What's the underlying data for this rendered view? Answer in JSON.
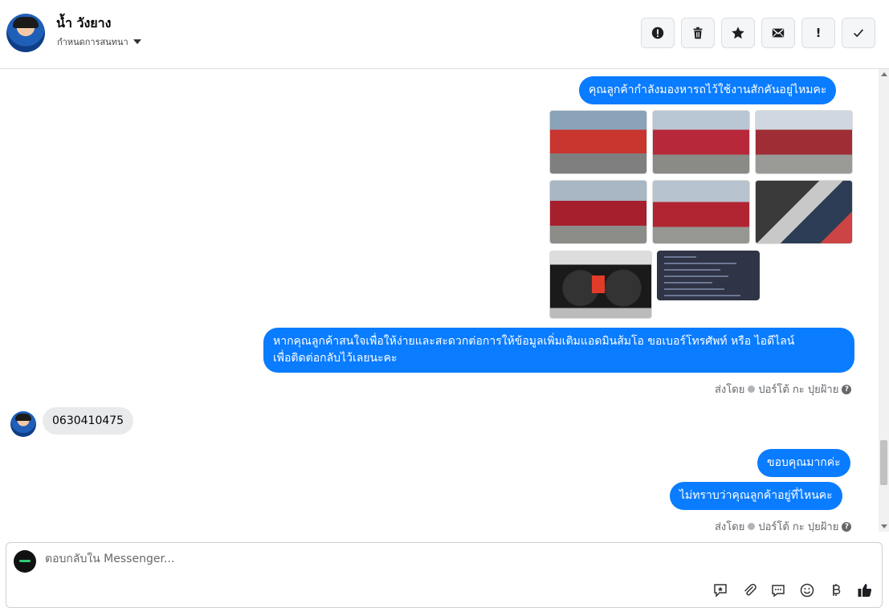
{
  "header": {
    "contact_name": "น้ำ วังยาง",
    "assign_label": "กำหนดการสนทนา",
    "toolbar": [
      {
        "name": "mark-spam-button",
        "icon": "alert-circle-icon"
      },
      {
        "name": "delete-button",
        "icon": "trash-icon"
      },
      {
        "name": "star-button",
        "icon": "star-icon"
      },
      {
        "name": "mark-unread-button",
        "icon": "envelope-icon"
      },
      {
        "name": "follow-up-button",
        "icon": "exclamation-icon",
        "label": "!"
      },
      {
        "name": "mark-done-button",
        "icon": "check-icon"
      }
    ]
  },
  "messages": {
    "m1": "คุณลูกค้ากำลังมองหารถไว้ใช้งานสักคันอยู่ไหมคะ",
    "m2_line1": "หากคุณลูกค้าสนใจเพื่อให้ง่ายและสะดวกต่อการให้ข้อมูลเพิ่มเติมแอดมินส้มโอ ขอเบอร์โทรศัพท์ หรือ ไอดีไลน์",
    "m2_line2": "เพื่อติดต่อกลับไว้เลยนะคะ",
    "sent_by_1": "ส่งโดย",
    "sender_1": "ปอร์โต้ กะ ปุยฝ้าย",
    "incoming": "0630410475",
    "m3": "ขอบคุณมากค่ะ",
    "m4": "ไม่ทราบว่าคุณลูกค้าอยู่ที่ไหนคะ",
    "sent_by_2": "ส่งโดย",
    "sender_2": "ปอร์โต้ กะ ปุยฝ้าย"
  },
  "attachments": {
    "photos": [
      "red-pickup-front-left",
      "red-pickup-front",
      "red-pickup-side",
      "red-pickup-front-lot",
      "red-pickup-rear",
      "pickup-interior-dashboard",
      "pickup-gauge-cluster",
      "vehicle-spec-card"
    ]
  },
  "composer": {
    "placeholder": "ตอบกลับใน Messenger...",
    "tools": [
      "saved-reply-icon",
      "attachment-icon",
      "chat-bubble-icon",
      "emoji-icon",
      "baht-payment-icon",
      "thumbs-up-icon"
    ]
  },
  "colors": {
    "accent": "#0a7cff",
    "incoming_bubble": "#e9eaec"
  }
}
